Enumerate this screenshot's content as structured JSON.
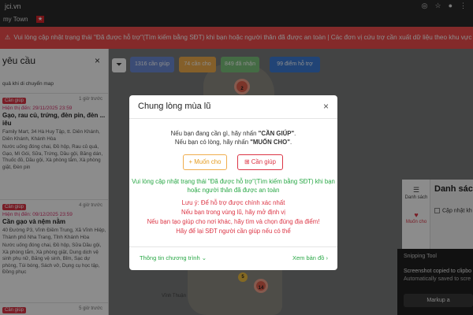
{
  "browser": {
    "url": "jci.vn",
    "bookmark": "my Town",
    "icons": [
      "eye-off-icon",
      "star-icon",
      "profile-icon",
      "menu-icon"
    ]
  },
  "banner": {
    "text": "Vui lòng cập nhật trạng thái \"Đã được hỗ trợ\"(Tìm kiếm bằng SĐT) khi bạn hoặc người thân đã được an toàn | Các đơn vị cứu trợ cần xuất dữ liệu theo khu vực",
    "color": "#f04e4e"
  },
  "left_panel": {
    "title": "yêu cầu",
    "close": "×",
    "hint": "quả khi di chuyển map",
    "cards": [
      {
        "badge": "Cần giúp",
        "ago": "1 giờ trước",
        "date": "Hiện thị đến: 29/11/2025 23:59",
        "title": "Gạo, rau củ, trứng, đèn pin, đèn ... iêu",
        "address": "Family Mart, 34 Hà Huy Tập, tt. Diên Khánh, Diên Khánh, Khánh Hòa",
        "items": "Nước uống đóng chai, Đồ hộp, Rau củ quả, Gạo, Mì Gói, Sữa, Trứng, Dầu gội, Băng dán, Thuốc đỏ, Dầu gội, Xà phòng tắm, Xà phòng giặt, Đèn pin"
      },
      {
        "badge": "Cần giúp",
        "ago": "4 giờ trước",
        "date": "Hiện thị đến: 09/12/2025 23:59",
        "title": "Cần gạo và nệm nằm",
        "address": "40 Đường P3, Vĩnh Điềm Trung, Xã Vĩnh Hiệp, Thành phố Nha Trang, Tỉnh Khánh Hòa",
        "items": "Nước uống đóng chai, Đồ hộp, Sữa Dầu gội, Xà phòng tắm, Xà phòng giặt, Dung dịch vệ sinh phụ nữ, Băng vệ sinh, Bỉm, Sạc dự phòng, Túi bóng, Sách vở, Dụng cụ học tập, Đồng phục"
      },
      {
        "badge": "Cần giúp",
        "ago": "5 giờ trước",
        "date": "",
        "title": "",
        "address": "",
        "items": ""
      }
    ]
  },
  "map": {
    "filter_icon": "filter-icon",
    "filters": [
      {
        "label": "1316 cần giúp",
        "color": "#6c8bd6"
      },
      {
        "label": "74 cần cho",
        "color": "#f0ad4e"
      },
      {
        "label": "849 đã nhận",
        "color": "#7cc47c"
      },
      {
        "label": "99 điểm hỗ trợ",
        "color": "#3d7dd8"
      }
    ],
    "markers": [
      {
        "label": "2"
      },
      {
        "label": "14"
      },
      {
        "label": "5"
      }
    ],
    "place_label": "Vĩnh Thuận"
  },
  "right_panel": {
    "tabs": [
      {
        "icon": "list-icon",
        "label": "Danh sách"
      },
      {
        "icon": "heart-icon",
        "label": "Muốn cho"
      }
    ],
    "title": "Danh sách",
    "checkbox_label": "Cập nhật kh"
  },
  "toast": {
    "app": "Snipping Tool",
    "message": "Screenshot copied to clipbo",
    "sub": "Automatically saved to scre",
    "button": "Markup a"
  },
  "modal": {
    "title": "Chung lòng mùa lũ",
    "close": "×",
    "intro_line1_pre": "Nếu bạn đang cần gì, hãy nhấn ",
    "intro_line1_bold": "\"CẦN GIÚP\"",
    "intro_line1_post": ".",
    "intro_line2_pre": "Nếu bạn có lòng, hãy nhấn ",
    "intro_line2_bold": "\"MUỐN CHO\"",
    "intro_line2_post": ".",
    "give_button": "Muốn cho",
    "need_button": "Cần giúp",
    "green_note": "Vui lòng cập nhật trạng thái \"Đã được hỗ trợ\"(Tìm kiếm bằng SĐT) khi bạn hoặc người thân đã được an toàn",
    "red_notes": [
      "Lưu ý: Để hỗ trợ được chính xác nhất",
      "Nếu bạn trong vùng lũ, hãy mở định vị",
      "Nếu bạn tạo giúp cho nơi khác, hãy tìm và chọn đúng địa điểm!",
      "Hãy để lại SĐT người cần giúp nếu có thể"
    ],
    "info_link": "Thông tin chương trình",
    "map_link": "Xem bản đồ"
  }
}
